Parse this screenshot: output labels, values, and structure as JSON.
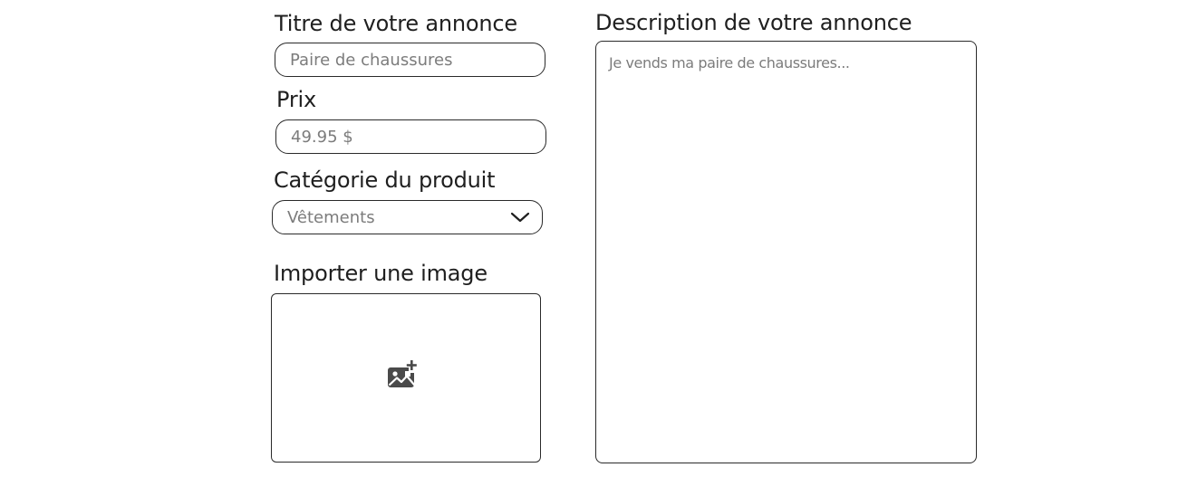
{
  "form": {
    "title_label": "Titre de votre annonce",
    "title_placeholder": "Paire de chaussures",
    "price_label": "Prix",
    "price_placeholder": "49.95 $",
    "category_label": "Catégorie du produit",
    "category_selected": "Vêtements",
    "image_label": "Importer une image",
    "image_icon": "add-image-icon",
    "description_label": "Description de votre annonce",
    "description_placeholder": "Je vends ma paire de chaussures..."
  },
  "colors": {
    "border": "#2a2a2a",
    "label_text": "#1f1f1f",
    "placeholder_text": "#7c7c7c",
    "icon": "#4a4a4a"
  }
}
